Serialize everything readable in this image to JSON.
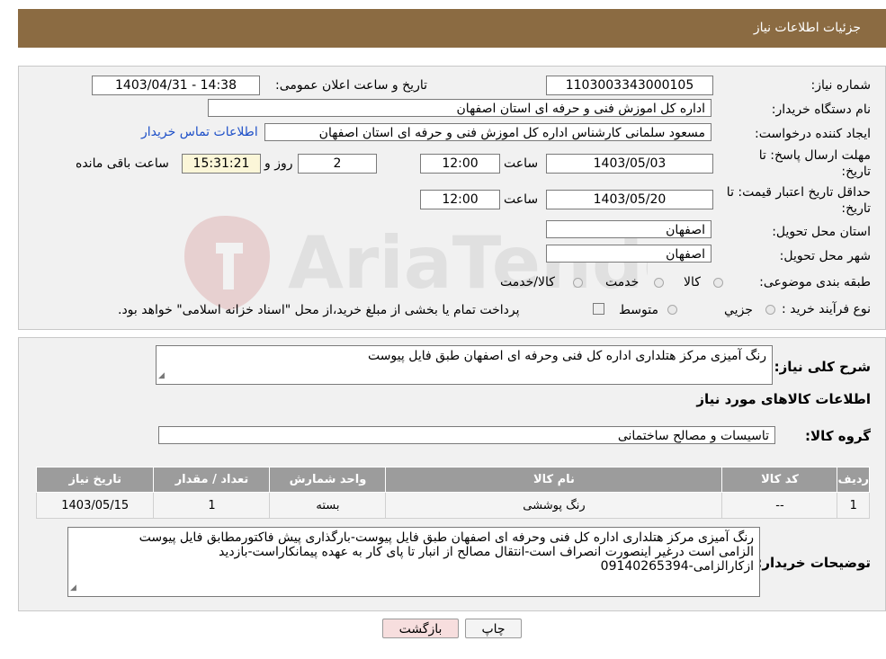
{
  "header": {
    "title": "جزئیات اطلاعات نیاز"
  },
  "form": {
    "need_number_label": "شماره نیاز:",
    "need_number": "1103003343000105",
    "announce_label": "تاریخ و ساعت اعلان عمومی:",
    "announce_value": "1403/04/31 - 14:38",
    "buyer_org_label": "نام دستگاه خریدار:",
    "buyer_org": "اداره کل اموزش فنی و حرفه ای استان اصفهان",
    "creator_label": "ایجاد کننده درخواست:",
    "creator": "مسعود سلمانی کارشناس اداره کل اموزش فنی و حرفه ای استان اصفهان",
    "contact_link": "اطلاعات تماس خریدار",
    "deadline_label_1": "مهلت ارسال پاسخ: تا",
    "deadline_label_2": "تاریخ:",
    "deadline_date": "1403/05/03",
    "time_label": "ساعت",
    "deadline_time": "12:00",
    "days_value": "2",
    "days_label": "روز و",
    "remaining_time": "15:31:21",
    "remaining_label": "ساعت باقی مانده",
    "validity_label_1": "حداقل تاریخ اعتبار قیمت: تا",
    "validity_label_2": "تاریخ:",
    "validity_date": "1403/05/20",
    "validity_time": "12:00",
    "province_label": "استان محل تحویل:",
    "province": "اصفهان",
    "city_label": "شهر محل تحویل:",
    "city": "اصفهان",
    "category_label": "طبقه بندی موضوعی:",
    "category_options": [
      "کالا",
      "خدمت",
      "کالا/خدمت"
    ],
    "purchase_label": "نوع فرآیند خرید :",
    "purchase_options": [
      "جزیي",
      "متوسط"
    ],
    "payment_note": "پرداخت تمام یا بخشی از مبلغ خرید،از محل \"اسناد خزانه اسلامی\" خواهد بود."
  },
  "summary": {
    "label": "شرح کلی نیاز:",
    "text": "رنگ آمیزی  مرکز هتلداری  اداره کل فنی وحرفه ای اصفهان طبق فایل پیوست"
  },
  "goods": {
    "section_title": "اطلاعات کالاهای مورد نیاز",
    "group_label": "گروه کالا:",
    "group_value": "تاسیسات و مصالح ساختمانی",
    "table_headers": [
      "ردیف",
      "کد کالا",
      "نام کالا",
      "واحد شمارش",
      "تعداد / مقدار",
      "تاریخ نیاز"
    ],
    "rows": [
      [
        "1",
        "--",
        "رنگ پوششی",
        "بسته",
        "1",
        "1403/05/15"
      ]
    ]
  },
  "buyer_notes": {
    "label": "توضیحات خریدار:",
    "line1": "رنگ آمیزی  مرکز هتلداری  اداره کل فنی وحرفه ای اصفهان طبق فایل پیوست-بارگذاری پیش فاکتورمطابق فایل  پیوست",
    "line2": "الزامی است درغیر اینصورت انصراف است-انتقال مصالح از انبار تا پای کار به عهده پیمانکاراست-بازدید",
    "line3": "ازکارالزامی-09140265394"
  },
  "buttons": {
    "print": "چاپ",
    "back": "بازگشت"
  },
  "colors": {
    "header_bg": "#8b6b42",
    "link": "#1e50c8",
    "back_button_bg": "#f7dede"
  }
}
